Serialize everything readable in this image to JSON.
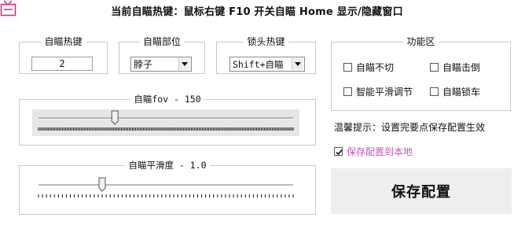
{
  "header": {
    "hint": "当前自瞄热键：鼠标右键  F10 开关自瞄  Home 显示/隐藏窗口",
    "app_icon": "tv-icon",
    "accent_color": "#e0218a"
  },
  "hotkey_group": {
    "label": "自瞄热键",
    "value": "2"
  },
  "part_group": {
    "label": "自瞄部位",
    "selected": "脖子"
  },
  "lock_group": {
    "label": "锁头热键",
    "selected": "Shift+自瞄"
  },
  "features": {
    "label": "功能区",
    "items": [
      {
        "label": "自瞄不切",
        "checked": false
      },
      {
        "label": "自瞄击倒",
        "checked": false
      },
      {
        "label": "智能平滑调节",
        "checked": false
      },
      {
        "label": "自瞄锁车",
        "checked": false
      }
    ]
  },
  "fov": {
    "label": "自瞄fov - 150",
    "value": 150,
    "min": 0,
    "max": 500
  },
  "smooth": {
    "label": "自瞄平滑度 - 1.0",
    "value": 1.0,
    "min": 0,
    "max": 4
  },
  "tip": "温馨提示：设置完要点保存配置生效",
  "save_local": {
    "label": "保存配置到本地",
    "checked": true,
    "color": "#c458b6"
  },
  "save_button": "保存配置"
}
